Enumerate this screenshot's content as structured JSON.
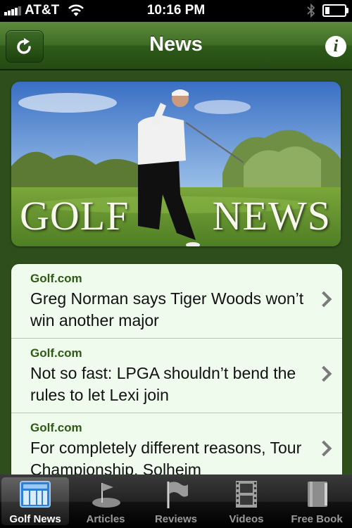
{
  "status_bar": {
    "carrier": "AT&T",
    "time": "10:16 PM",
    "battery_level": 0.25
  },
  "nav_bar": {
    "title": "News",
    "left_button_icon": "refresh-icon",
    "right_button_icon": "info-icon",
    "info_glyph": "i"
  },
  "banner": {
    "word_left": "GOLF",
    "word_right": "NEWS"
  },
  "news_items": [
    {
      "source": "Golf.com",
      "headline": "Greg Norman says Tiger Woods won’t win another major"
    },
    {
      "source": "Golf.com",
      "headline": "Not so fast: LPGA shouldn’t bend the rules to let Lexi join"
    },
    {
      "source": "Golf.com",
      "headline": "For completely different reasons, Tour Championship, Solheim"
    }
  ],
  "tab_bar": {
    "tabs": [
      {
        "label": "Golf News",
        "icon": "newspaper-icon",
        "selected": true
      },
      {
        "label": "Articles",
        "icon": "golf-flag-icon",
        "selected": false
      },
      {
        "label": "Reviews",
        "icon": "flag-icon",
        "selected": false
      },
      {
        "label": "Videos",
        "icon": "film-icon",
        "selected": false
      },
      {
        "label": "Free Book",
        "icon": "book-icon",
        "selected": false
      }
    ]
  },
  "colors": {
    "nav_green": "#3f6d26",
    "background_green": "#2e4f1c",
    "list_background": "#effced",
    "source_green": "#2f5a16"
  }
}
